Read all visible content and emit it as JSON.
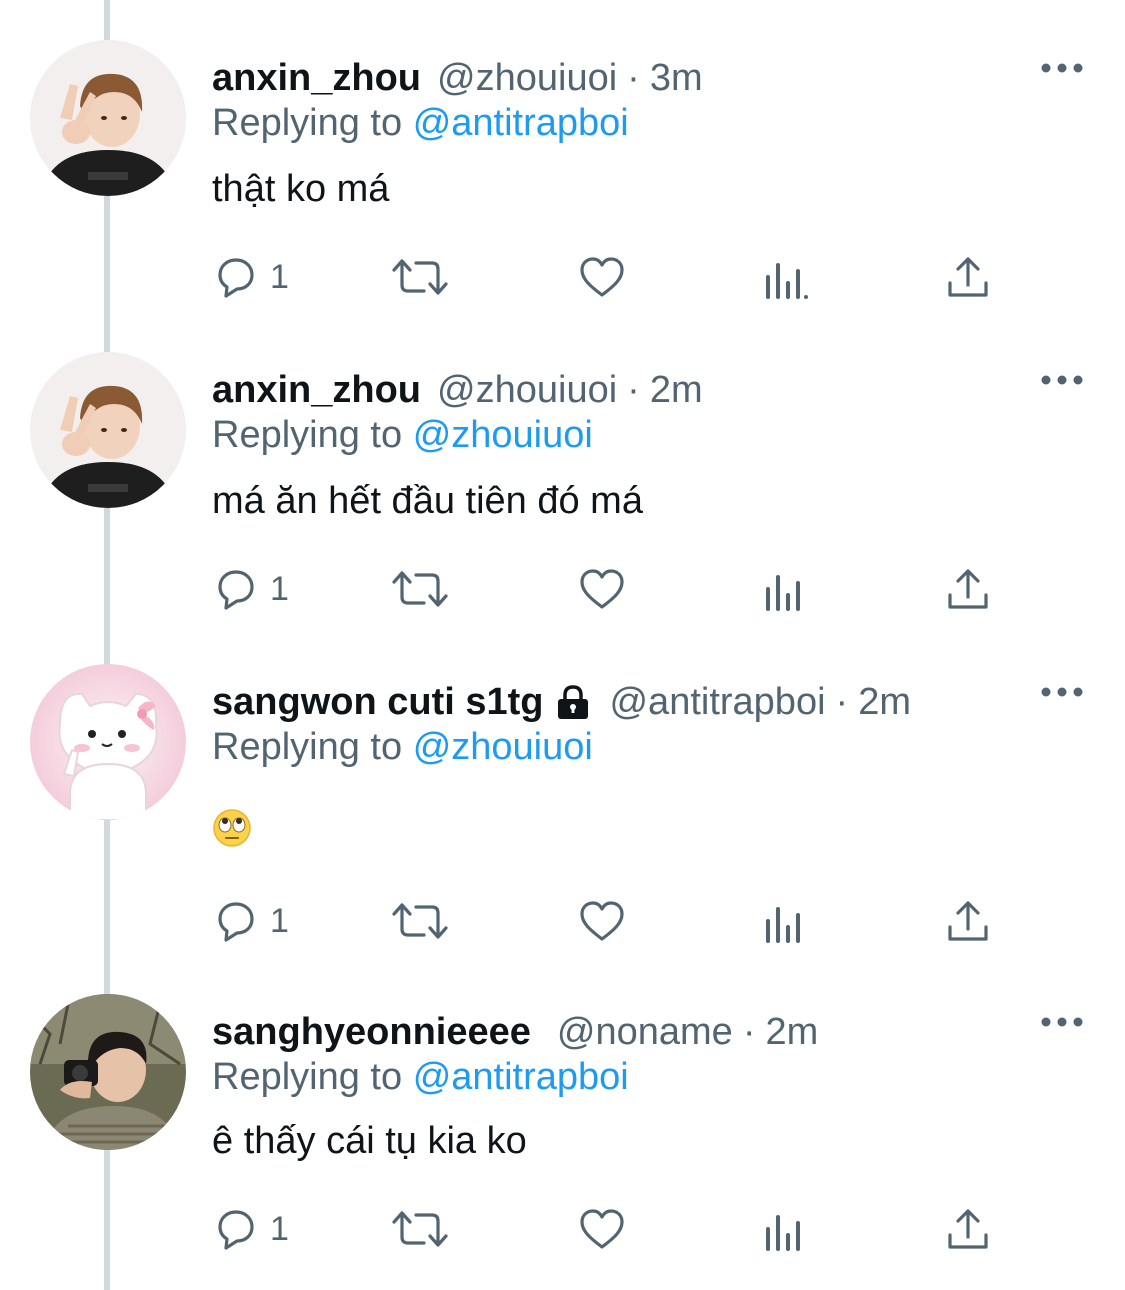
{
  "tweets": [
    {
      "display_name": "anxin_zhou",
      "handle": "@zhouiuoi",
      "separator": "·",
      "time": "3m",
      "replying_prefix": "Replying to",
      "replying_to": "@antitrapboi",
      "text": "thật ko má",
      "reply_count": "1",
      "avatar": "boy-peace-sign-avatar",
      "protected": false
    },
    {
      "display_name": "anxin_zhou",
      "handle": "@zhouiuoi",
      "separator": "·",
      "time": "2m",
      "replying_prefix": "Replying to",
      "replying_to": "@zhouiuoi",
      "text": "má ăn hết đầu tiên đó má",
      "reply_count": "1",
      "avatar": "boy-peace-sign-avatar",
      "protected": false
    },
    {
      "display_name": "sangwon cuti s1tg",
      "handle": "@antitrapboi",
      "separator": "·",
      "time": "2m",
      "replying_prefix": "Replying to",
      "replying_to": "@zhouiuoi",
      "text": "🙄",
      "reply_count": "1",
      "avatar": "white-cat-bow-avatar",
      "protected": true
    },
    {
      "display_name": "sanghyeonnieeee",
      "handle": "@noname",
      "separator": "·",
      "time": "2m",
      "replying_prefix": "Replying to",
      "replying_to": "@antitrapboi",
      "text": "ê thấy cái tụ kia ko",
      "reply_count": "1",
      "avatar": "boy-camera-avatar",
      "protected": false
    }
  ],
  "icons": {
    "reply": "reply-icon",
    "retweet": "retweet-icon",
    "like": "heart-icon",
    "views": "views-icon",
    "share": "share-icon",
    "more": "more-icon",
    "lock": "lock-icon"
  },
  "colors": {
    "text": "#0f1419",
    "secondary": "#536471",
    "mention": "#1d9bf0",
    "thread_line": "#cfd9de",
    "background": "#ffffff"
  }
}
